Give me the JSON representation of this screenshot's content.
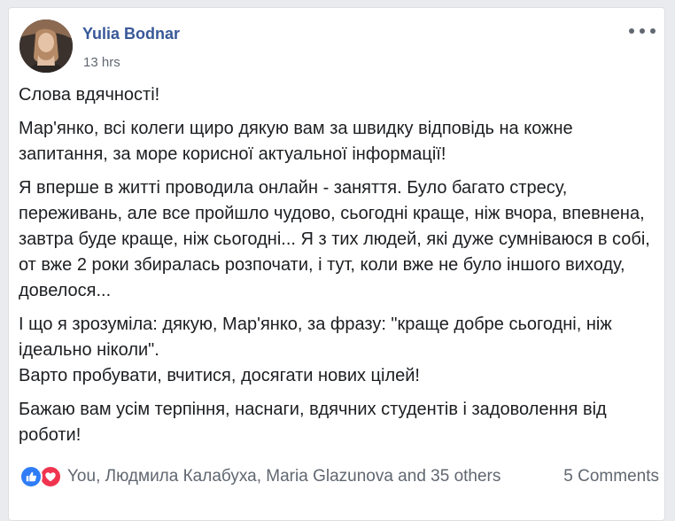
{
  "post": {
    "author": "Yulia Bodnar",
    "timestamp": "13 hrs",
    "paragraphs": [
      "Слова вдячності!",
      "Мар'янко, всі колеги щиро дякую вам за швидку відповідь на кожне запитання, за море корисної актуальної інформації!",
      "Я вперше в житті проводила онлайн - заняття. Було багато стресу, переживань, але все пройшло чудово, сьогодні краще, ніж вчора, впевнена, завтра буде краще, ніж сьогодні... Я з тих людей, які дуже сумніваюся в собі, от вже 2 роки збиралась розпочати, і тут, коли вже не було іншого виходу, довелося...",
      "І що я зрозуміла: дякую, Мар'янко, за фразу: \"краще добре сьогодні, ніж ідеально ніколи\".\nВарто пробувати, вчитися, досягати нових цілей!",
      "Бажаю вам усім терпіння, наснаги, вдячних студентів і задоволення від роботи!"
    ]
  },
  "footer": {
    "reactions_icons": [
      "like-icon",
      "love-icon"
    ],
    "reactors_text": "You, Людмила Калабуха, Maria Glazunova and 35 others",
    "comments_text": "5 Comments"
  },
  "colors": {
    "author_link": "#385898",
    "like": "#2f7cf6",
    "love": "#f0344f",
    "meta_text": "#606770"
  }
}
